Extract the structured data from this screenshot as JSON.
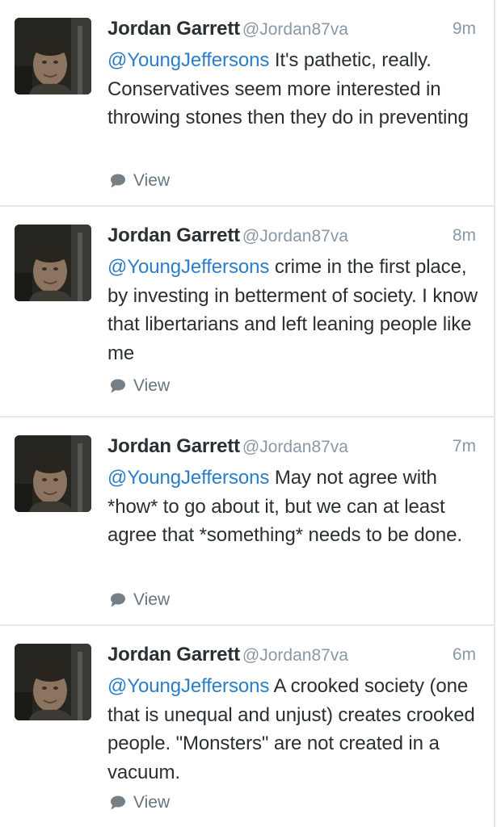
{
  "tweets": [
    {
      "name": "Jordan Garrett",
      "handle": "@Jordan87va",
      "time": "9m",
      "mention": "@YoungJeffersons",
      "body": " It's pathetic, really.  Conservatives seem more interested in throwing stones then they do in preventing",
      "action": "View"
    },
    {
      "name": "Jordan Garrett",
      "handle": "@Jordan87va",
      "time": "8m",
      "mention": "@YoungJeffersons",
      "body": " crime in the first place, by investing in betterment of society.  I know that libertarians and left leaning people like me",
      "action": "View"
    },
    {
      "name": "Jordan Garrett",
      "handle": "@Jordan87va",
      "time": "7m",
      "mention": "@YoungJeffersons",
      "body": " May not agree with *how* to go about it, but we can at least agree that *something* needs to be done.",
      "action": "View"
    },
    {
      "name": "Jordan Garrett",
      "handle": "@Jordan87va",
      "time": "6m",
      "mention": "@YoungJeffersons",
      "body": " A crooked society (one that is unequal and unjust) creates crooked people.  \"Monsters\" are not created in a vacuum.",
      "action": "View"
    }
  ],
  "icons": {
    "view": "speech-bubble-icon",
    "avatar": "profile-photo"
  },
  "colors": {
    "mention": "#2a7ec8",
    "meta": "#8899a6",
    "text": "#292f33",
    "divider": "#e1e8ed"
  }
}
